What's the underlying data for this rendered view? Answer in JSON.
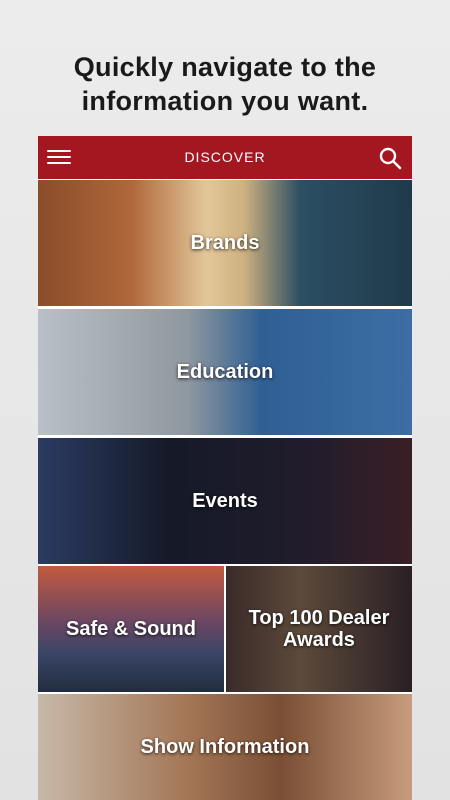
{
  "headline": {
    "line1": "Quickly navigate to the",
    "line2": "information you want."
  },
  "topbar": {
    "title": "DISCOVER",
    "menu_icon": "hamburger-menu-icon",
    "search_icon": "search-icon",
    "color": "#a51720"
  },
  "tiles": [
    {
      "label": "Brands"
    },
    {
      "label": "Education"
    },
    {
      "label": "Events"
    },
    {
      "label": "Safe & Sound"
    },
    {
      "label": "Top 100 Dealer Awards"
    },
    {
      "label": "Show Information"
    }
  ]
}
